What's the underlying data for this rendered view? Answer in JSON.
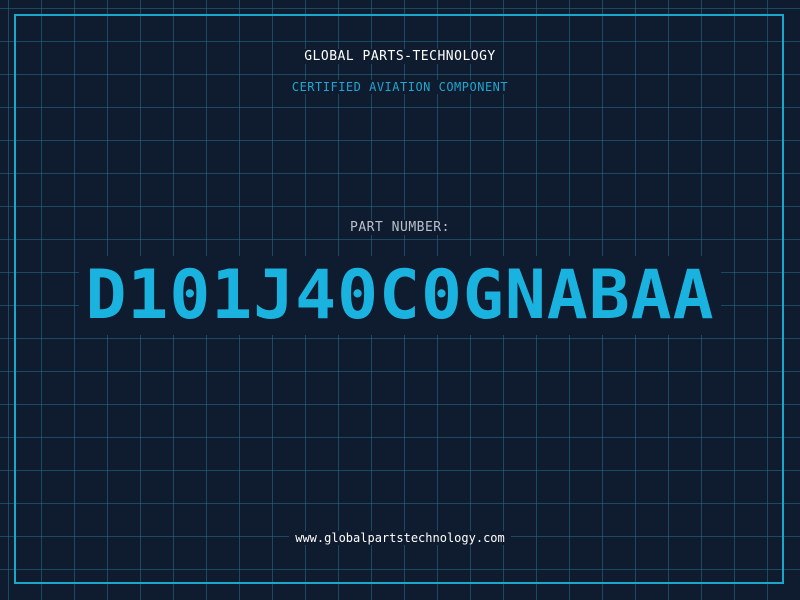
{
  "header": {
    "company": "GLOBAL PARTS-TECHNOLOGY",
    "subtitle": "CERTIFIED AVIATION COMPONENT"
  },
  "part": {
    "label": "PART NUMBER:",
    "number": "D101J40C0GNABAA"
  },
  "footer": {
    "url": "www.globalpartstechnology.com"
  },
  "colors": {
    "background": "#0f1b2e",
    "grid": "#286e8c",
    "frame": "#1aa7c9",
    "accent": "#1ab3e0"
  }
}
